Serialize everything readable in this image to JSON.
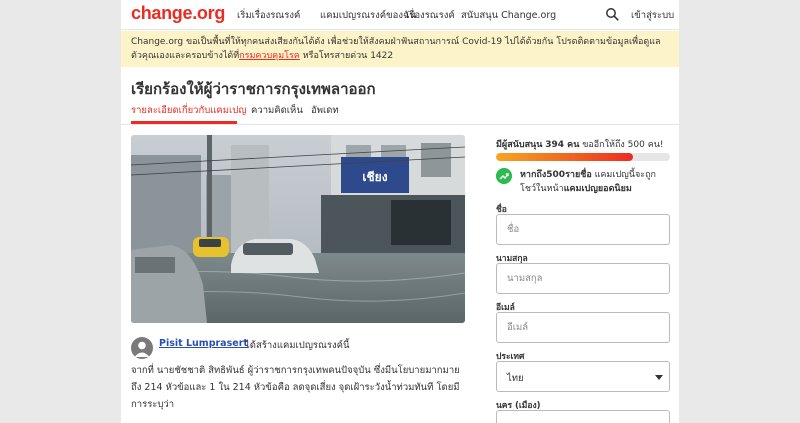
{
  "header": {
    "logo": "change.org",
    "nav": [
      "เริ่มเรื่องรณรงค์",
      "แคมเปญรณรงค์ของฉัน",
      "เรื่องรณรงค์",
      "สนับสนุน Change.org"
    ],
    "login": "เข้าสู่ระบบ"
  },
  "banner": {
    "text_1": "Change.org ขอเป็นพื้นที่ให้ทุกคนส่งเสียงกันได้ดัง เพื่อช่วยให้สังคมฝ่าฟันสถานการณ์ Covid-19 ไปได้ด้วยกัน โปรดติดตามข้อมูลเพื่อดูแลตัวคุณเองและครอบข้างได้ที่",
    "link": "กรมควบคุมโรค",
    "text_2": " หรือโทรสายด่วน 1422"
  },
  "petition": {
    "title": "เรียกร้องให้ผู้ว่าราชการกรุงเทพลาออก",
    "tabs": [
      "รายละเอียดเกี่ยวกับแคมเปญ",
      "ความคิดเห็น",
      "อัพเดท"
    ],
    "author": "Pisit Lumprasert",
    "author_action": "ได้สร้างแคมเปญรณรงค์นี้",
    "body": "จากที่ นายชัชชาติ สิทธิพันธ์ ผู้ว่าราชการกรุงเทพคนปัจจุบัน ซึ่งมีนโยบายมากมายถึง 214 หัวข้อและ 1 ใน 214 หัวข้อคือ ลดจุดเสี่ยง จุดเฝ้าระวังน้ำท่วมทันที  โดยมีการระบุว่า",
    "photo_sign": "เชียง"
  },
  "sidebar": {
    "supporters_prefix": "มีผู้สนับสนุน",
    "supporters_count": "394 คน",
    "supporters_suffix": " ขออีกให้ถึง 500 คน!",
    "progress": 0.788,
    "trend_bold": "หากถึง500รายชื่อ",
    "trend_text": " แคมเปญนี้จะถูกโชว์ในหน้า",
    "trend_bold_2": "แคมเปญยอดนิยม",
    "fields": [
      {
        "label": "ชื่อ",
        "placeholder": "ชื่อ"
      },
      {
        "label": "นามสกุล",
        "placeholder": "นามสกุล"
      },
      {
        "label": "อีเมล์",
        "placeholder": "อีเมล์"
      }
    ],
    "country_label": "ประเทศ",
    "country_value": "ไทย",
    "city_label": "นคร (เมือง)"
  },
  "colors": {
    "brand": "#ec2c22",
    "banner_bg": "#fdf3c9",
    "link_blue": "#2a4fb4",
    "trend_green": "#2dbb4f"
  }
}
